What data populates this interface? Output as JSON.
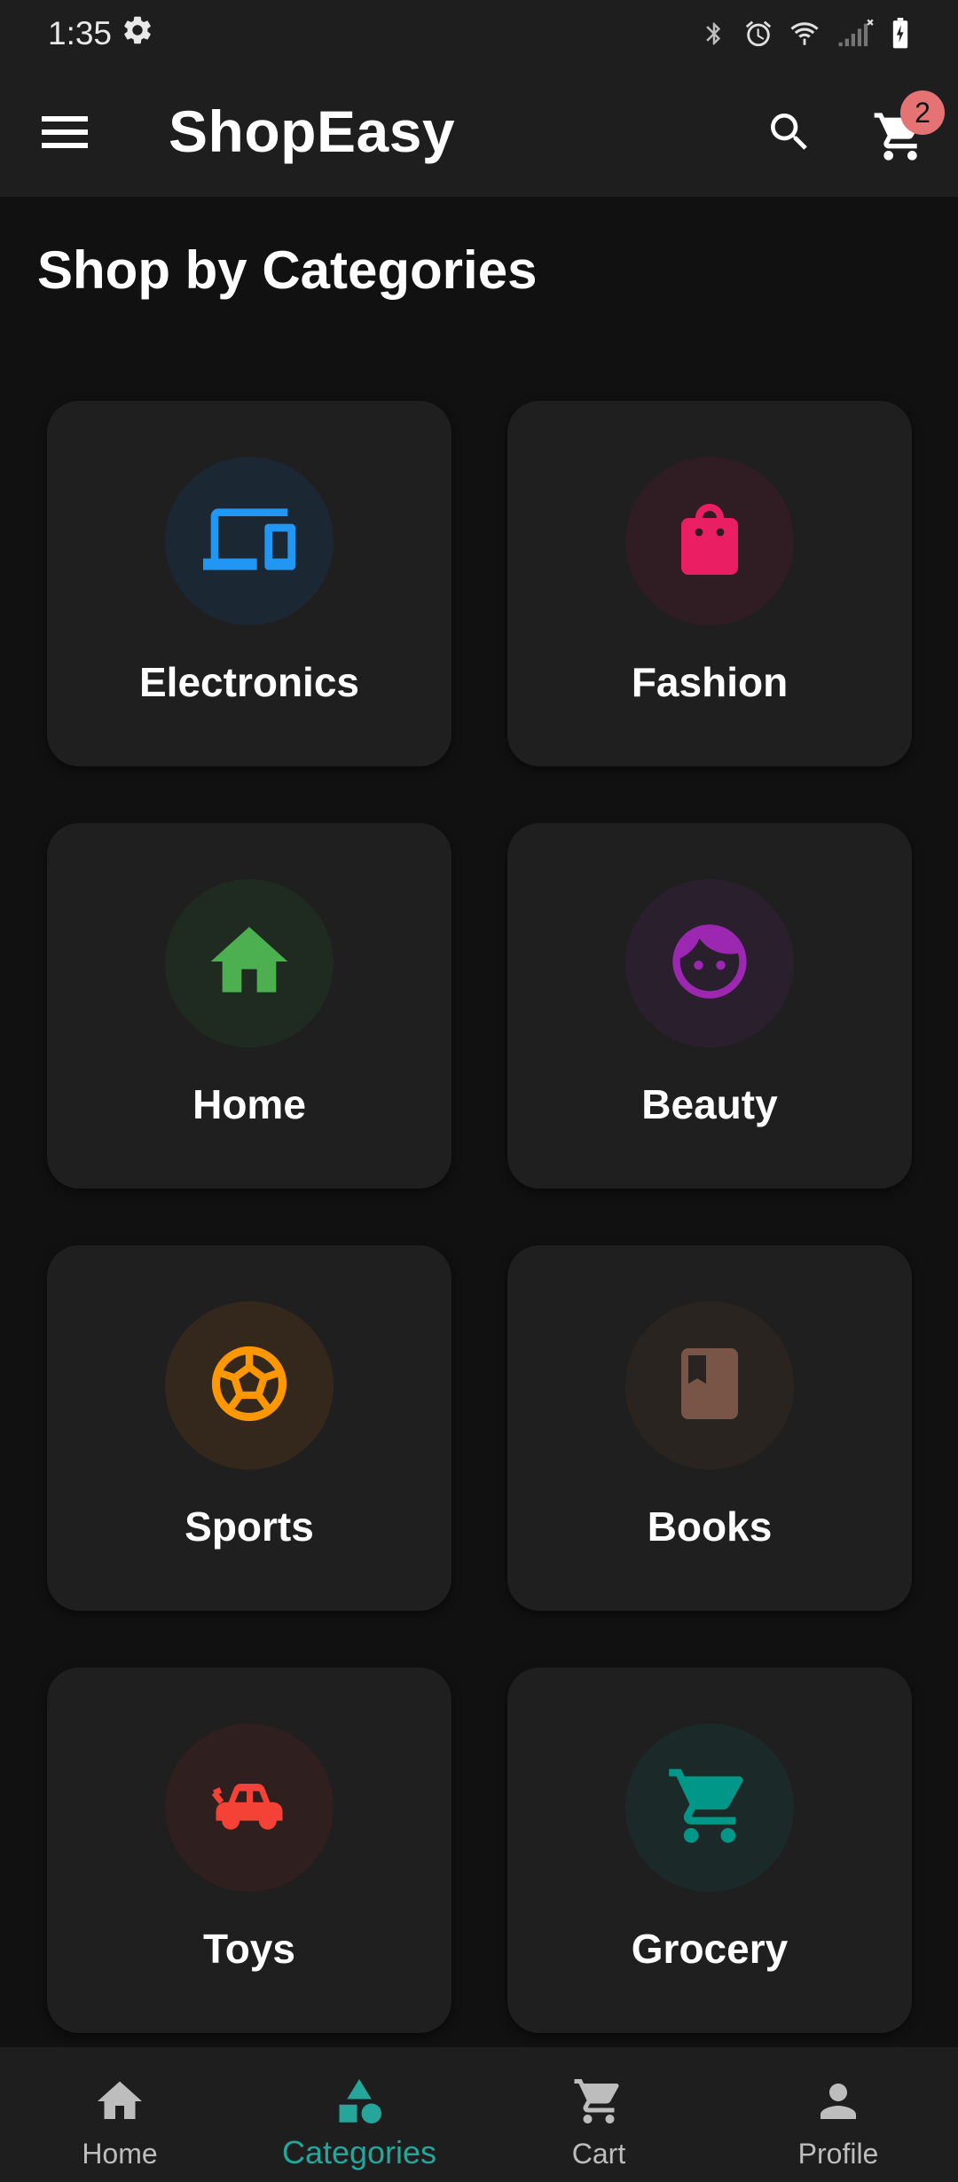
{
  "status_bar": {
    "time": "1:35",
    "icons": [
      "settings-icon",
      "bluetooth-icon",
      "alarm-icon",
      "wifi-icon",
      "signal-icon",
      "battery-icon"
    ]
  },
  "app_bar": {
    "title": "ShopEasy",
    "menu_icon": "menu-icon",
    "search_icon": "search-icon",
    "cart_icon": "cart-icon",
    "cart_count": "2"
  },
  "section": {
    "title": "Shop by Categories"
  },
  "categories": [
    {
      "label": "Electronics",
      "icon": "devices-icon",
      "color": "#2196f3",
      "bg": "#1b2733"
    },
    {
      "label": "Fashion",
      "icon": "shopping-bag-icon",
      "color": "#e91e63",
      "bg": "#301d24"
    },
    {
      "label": "Home",
      "icon": "home-icon",
      "color": "#4caf50",
      "bg": "#1f2a20"
    },
    {
      "label": "Beauty",
      "icon": "face-icon",
      "color": "#9c27b0",
      "bg": "#2a1f2d"
    },
    {
      "label": "Sports",
      "icon": "soccer-ball-icon",
      "color": "#ff9800",
      "bg": "#33281b"
    },
    {
      "label": "Books",
      "icon": "book-icon",
      "color": "#795548",
      "bg": "#2a2420"
    },
    {
      "label": "Toys",
      "icon": "toy-car-icon",
      "color": "#f44336",
      "bg": "#2f1f1e"
    },
    {
      "label": "Grocery",
      "icon": "shopping-cart-icon",
      "color": "#009688",
      "bg": "#1b2a28"
    }
  ],
  "bottom_nav": {
    "items": [
      {
        "label": "Home",
        "icon": "home-icon"
      },
      {
        "label": "Categories",
        "icon": "category-icon"
      },
      {
        "label": "Cart",
        "icon": "cart-icon"
      },
      {
        "label": "Profile",
        "icon": "person-icon"
      }
    ],
    "active": "Categories",
    "active_color": "#26a69a"
  }
}
